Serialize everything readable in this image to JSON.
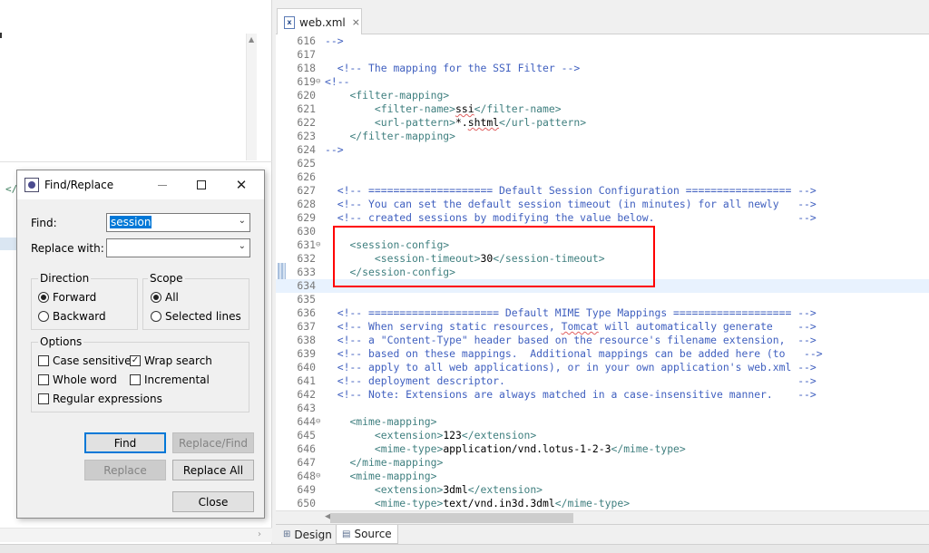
{
  "editor": {
    "tab_label": "web.xml",
    "lines": [
      {
        "n": "616",
        "fold": "",
        "current": false,
        "html": "<span class=\"c\">--></span>"
      },
      {
        "n": "617",
        "fold": "",
        "current": false,
        "html": ""
      },
      {
        "n": "618",
        "fold": "",
        "current": false,
        "html": "  <span class=\"c\">&lt;!-- The mapping for the SSI Filter --></span>"
      },
      {
        "n": "619",
        "fold": "⊖",
        "current": false,
        "html": "<span class=\"c\">&lt;!--</span>"
      },
      {
        "n": "620",
        "fold": "",
        "current": false,
        "html": "    <span class=\"t\">&lt;filter-mapping></span>"
      },
      {
        "n": "621",
        "fold": "",
        "current": false,
        "html": "        <span class=\"t\">&lt;filter-name></span><span class=\"x s\">ssi</span><span class=\"t\">&lt;/filter-name></span>"
      },
      {
        "n": "622",
        "fold": "",
        "current": false,
        "html": "        <span class=\"t\">&lt;url-pattern></span><span class=\"x\">*.</span><span class=\"x s\">shtml</span><span class=\"t\">&lt;/url-pattern></span>"
      },
      {
        "n": "623",
        "fold": "",
        "current": false,
        "html": "    <span class=\"t\">&lt;/filter-mapping></span>"
      },
      {
        "n": "624",
        "fold": "",
        "current": false,
        "html": "<span class=\"c\">--></span>"
      },
      {
        "n": "625",
        "fold": "",
        "current": false,
        "html": ""
      },
      {
        "n": "626",
        "fold": "",
        "current": false,
        "html": ""
      },
      {
        "n": "627",
        "fold": "",
        "current": false,
        "html": "  <span class=\"c\">&lt;!-- ==================== Default Session Configuration ================= --></span>"
      },
      {
        "n": "628",
        "fold": "",
        "current": false,
        "html": "  <span class=\"c\">&lt;!-- You can set the default session timeout (in minutes) for all newly   --></span>"
      },
      {
        "n": "629",
        "fold": "",
        "current": false,
        "html": "  <span class=\"c\">&lt;!-- created sessions by modifying the value below.                       --></span>"
      },
      {
        "n": "630",
        "fold": "",
        "current": false,
        "html": ""
      },
      {
        "n": "631",
        "fold": "⊖",
        "current": false,
        "html": "    <span class=\"t\">&lt;session-config></span>"
      },
      {
        "n": "632",
        "fold": "",
        "current": false,
        "html": "        <span class=\"t\">&lt;session-timeout></span><span class=\"x\">30</span><span class=\"t\">&lt;/session-timeout></span>"
      },
      {
        "n": "633",
        "fold": "",
        "current": false,
        "html": "    <span class=\"t\">&lt;/session-config></span>"
      },
      {
        "n": "634",
        "fold": "",
        "current": true,
        "html": ""
      },
      {
        "n": "635",
        "fold": "",
        "current": false,
        "html": ""
      },
      {
        "n": "636",
        "fold": "",
        "current": false,
        "html": "  <span class=\"c\">&lt;!-- ===================== Default MIME Type Mappings =================== --></span>"
      },
      {
        "n": "637",
        "fold": "",
        "current": false,
        "html": "  <span class=\"c\">&lt;!-- When serving static resources, <span class=\"s\">Tomcat</span> will automatically generate    --></span>"
      },
      {
        "n": "638",
        "fold": "",
        "current": false,
        "html": "  <span class=\"c\">&lt;!-- a \"Content-Type\" header based on the resource's filename extension,  --></span>"
      },
      {
        "n": "639",
        "fold": "",
        "current": false,
        "html": "  <span class=\"c\">&lt;!-- based on these mappings.  Additional mappings can be added here (to   --></span>"
      },
      {
        "n": "640",
        "fold": "",
        "current": false,
        "html": "  <span class=\"c\">&lt;!-- apply to all web applications), or in your own application's web.xml --></span>"
      },
      {
        "n": "641",
        "fold": "",
        "current": false,
        "html": "  <span class=\"c\">&lt;!-- deployment descriptor.                                               --></span>"
      },
      {
        "n": "642",
        "fold": "",
        "current": false,
        "html": "  <span class=\"c\">&lt;!-- Note: Extensions are always matched in a case-insensitive manner.    --></span>"
      },
      {
        "n": "643",
        "fold": "",
        "current": false,
        "html": ""
      },
      {
        "n": "644",
        "fold": "⊖",
        "current": false,
        "html": "    <span class=\"t\">&lt;mime-mapping></span>"
      },
      {
        "n": "645",
        "fold": "",
        "current": false,
        "html": "        <span class=\"t\">&lt;extension></span><span class=\"x\">123</span><span class=\"t\">&lt;/extension></span>"
      },
      {
        "n": "646",
        "fold": "",
        "current": false,
        "html": "        <span class=\"t\">&lt;mime-type></span><span class=\"x\">application/vnd.lotus-1-2-3</span><span class=\"t\">&lt;/mime-type></span>"
      },
      {
        "n": "647",
        "fold": "",
        "current": false,
        "html": "    <span class=\"t\">&lt;/mime-mapping></span>"
      },
      {
        "n": "648",
        "fold": "⊖",
        "current": false,
        "html": "    <span class=\"t\">&lt;mime-mapping></span>"
      },
      {
        "n": "649",
        "fold": "",
        "current": false,
        "html": "        <span class=\"t\">&lt;extension></span><span class=\"x\">3dml</span><span class=\"t\">&lt;/extension></span>"
      },
      {
        "n": "650",
        "fold": "",
        "current": false,
        "html": "        <span class=\"t\">&lt;mime-type></span><span class=\"x\">text/vnd.in3d.3dml</span><span class=\"t\">&lt;/mime-type></span>"
      }
    ]
  },
  "bottom_tabs": {
    "design": "Design",
    "source": "Source"
  },
  "left_panel": {
    "green_text": "</"
  },
  "dialog": {
    "title": "Find/Replace",
    "find_label": "Find:",
    "find_value": "session",
    "replace_label": "Replace with:",
    "replace_value": "",
    "direction_title": "Direction",
    "forward": "Forward",
    "backward": "Backward",
    "scope_title": "Scope",
    "all": "All",
    "selected_lines": "Selected lines",
    "options_title": "Options",
    "case_sensitive": "Case sensitive",
    "wrap_search": "Wrap search",
    "whole_word": "Whole word",
    "incremental": "Incremental",
    "regular_expressions": "Regular expressions",
    "btn_find": "Find",
    "btn_replace_find": "Replace/Find",
    "btn_replace": "Replace",
    "btn_replace_all": "Replace All",
    "btn_close": "Close"
  },
  "icons": {
    "close": "close-icon",
    "dropdown": "chevron-down-icon"
  },
  "colors": {
    "highlight": "#ff0000",
    "selection": "#0078d7",
    "comment": "#3f5fbf",
    "tag": "#3f7f7f"
  }
}
